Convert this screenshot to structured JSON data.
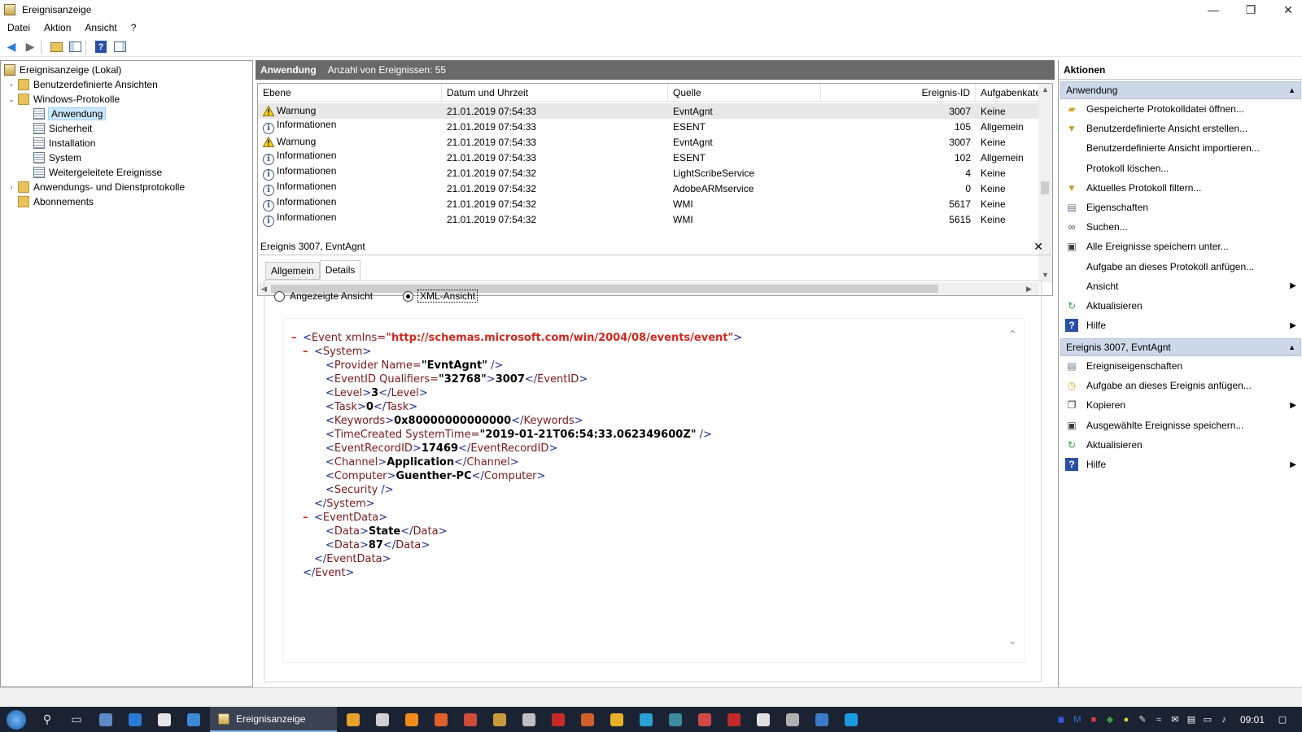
{
  "window": {
    "title": "Ereignisanzeige",
    "controls": {
      "minimize": "—",
      "maximize": "❐",
      "close": "✕"
    }
  },
  "menu": [
    "Datei",
    "Aktion",
    "Ansicht",
    "?"
  ],
  "toolbar": {
    "icons": [
      "back-arrow-icon",
      "forward-arrow-icon",
      "folder-up-icon",
      "show-hide-tree-icon",
      "help-icon",
      "action-pane-icon"
    ]
  },
  "tree": {
    "root": "Ereignisanzeige (Lokal)",
    "custom_views": "Benutzerdefinierte Ansichten",
    "windows_logs": "Windows-Protokolle",
    "logs": [
      "Anwendung",
      "Sicherheit",
      "Installation",
      "System",
      "Weitergeleitete Ereignisse"
    ],
    "app_service_logs": "Anwendungs- und Dienstprotokolle",
    "subscriptions": "Abonnements"
  },
  "center": {
    "header_title": "Anwendung",
    "header_count": "Anzahl von Ereignissen: 55",
    "columns": [
      "Ebene",
      "Datum und Uhrzeit",
      "Quelle",
      "Ereignis-ID",
      "Aufgabenkate"
    ],
    "rows": [
      {
        "level": "Warnung",
        "icon": "warning-icon",
        "date": "21.01.2019 07:54:33",
        "source": "EvntAgnt",
        "id": "3007",
        "task": "Keine"
      },
      {
        "level": "Informationen",
        "icon": "info-icon",
        "date": "21.01.2019 07:54:33",
        "source": "ESENT",
        "id": "105",
        "task": "Allgemein"
      },
      {
        "level": "Warnung",
        "icon": "warning-icon",
        "date": "21.01.2019 07:54:33",
        "source": "EvntAgnt",
        "id": "3007",
        "task": "Keine"
      },
      {
        "level": "Informationen",
        "icon": "info-icon",
        "date": "21.01.2019 07:54:33",
        "source": "ESENT",
        "id": "102",
        "task": "Allgemein"
      },
      {
        "level": "Informationen",
        "icon": "info-icon",
        "date": "21.01.2019 07:54:32",
        "source": "LightScribeService",
        "id": "4",
        "task": "Keine"
      },
      {
        "level": "Informationen",
        "icon": "info-icon",
        "date": "21.01.2019 07:54:32",
        "source": "AdobeARMservice",
        "id": "0",
        "task": "Keine"
      },
      {
        "level": "Informationen",
        "icon": "info-icon",
        "date": "21.01.2019 07:54:32",
        "source": "WMI",
        "id": "5617",
        "task": "Keine"
      },
      {
        "level": "Informationen",
        "icon": "info-icon",
        "date": "21.01.2019 07:54:32",
        "source": "WMI",
        "id": "5615",
        "task": "Keine"
      }
    ]
  },
  "detail": {
    "title": "Ereignis 3007, EvntAgnt",
    "tabs": [
      "Allgemein",
      "Details"
    ],
    "radio_friendly": "Angezeigte Ansicht",
    "radio_xml": "XML-Ansicht",
    "xml": {
      "event_open": "Event",
      "event_attr": " xmlns=",
      "event_ns": "\"http://schemas.microsoft.com/win/2004/08/events/event\"",
      "provider_name": "EvntAgnt",
      "qualifiers": "32768",
      "event_id": "3007",
      "level": "3",
      "task": "0",
      "keywords": "0x80000000000000",
      "time_created": "2019-01-21T06:54:33.062349600Z",
      "record_id": "17469",
      "channel": "Application",
      "computer": "Guenther-PC",
      "data1": "State",
      "data2": "87"
    }
  },
  "actions": {
    "title": "Aktionen",
    "section1": "Anwendung",
    "items1": [
      {
        "label": "Gespeicherte Protokolldatei öffnen...",
        "icon": "open-folder-icon"
      },
      {
        "label": "Benutzerdefinierte Ansicht erstellen...",
        "icon": "filter-icon"
      },
      {
        "label": "Benutzerdefinierte Ansicht importieren...",
        "icon": ""
      },
      {
        "label": "Protokoll löschen...",
        "icon": ""
      },
      {
        "label": "Aktuelles Protokoll filtern...",
        "icon": "filter-icon"
      },
      {
        "label": "Eigenschaften",
        "icon": "properties-icon"
      },
      {
        "label": "Suchen...",
        "icon": "binoculars-icon"
      },
      {
        "label": "Alle Ereignisse speichern unter...",
        "icon": "save-icon"
      },
      {
        "label": "Aufgabe an dieses Protokoll anfügen...",
        "icon": ""
      },
      {
        "label": "Ansicht",
        "icon": "",
        "submenu": true
      },
      {
        "label": "Aktualisieren",
        "icon": "refresh-icon"
      },
      {
        "label": "Hilfe",
        "icon": "help-icon",
        "submenu": true
      }
    ],
    "section2": "Ereignis 3007, EvntAgnt",
    "items2": [
      {
        "label": "Ereigniseigenschaften",
        "icon": "properties-icon"
      },
      {
        "label": "Aufgabe an dieses Ereignis anfügen...",
        "icon": "task-icon"
      },
      {
        "label": "Kopieren",
        "icon": "copy-icon",
        "submenu": true
      },
      {
        "label": "Ausgewählte Ereignisse speichern...",
        "icon": "save-icon"
      },
      {
        "label": "Aktualisieren",
        "icon": "refresh-icon"
      },
      {
        "label": "Hilfe",
        "icon": "help-icon",
        "submenu": true
      }
    ]
  },
  "taskbar": {
    "active_app": "Ereignisanzeige",
    "clock": "09:01"
  },
  "colors": {
    "header_bg": "#696969",
    "section_bg": "#cdd9e8",
    "xml_tag": "#7a1a1a",
    "xml_bracket": "#1f2b8a",
    "xml_url": "#d0281e",
    "taskbar": "#1b2332"
  }
}
